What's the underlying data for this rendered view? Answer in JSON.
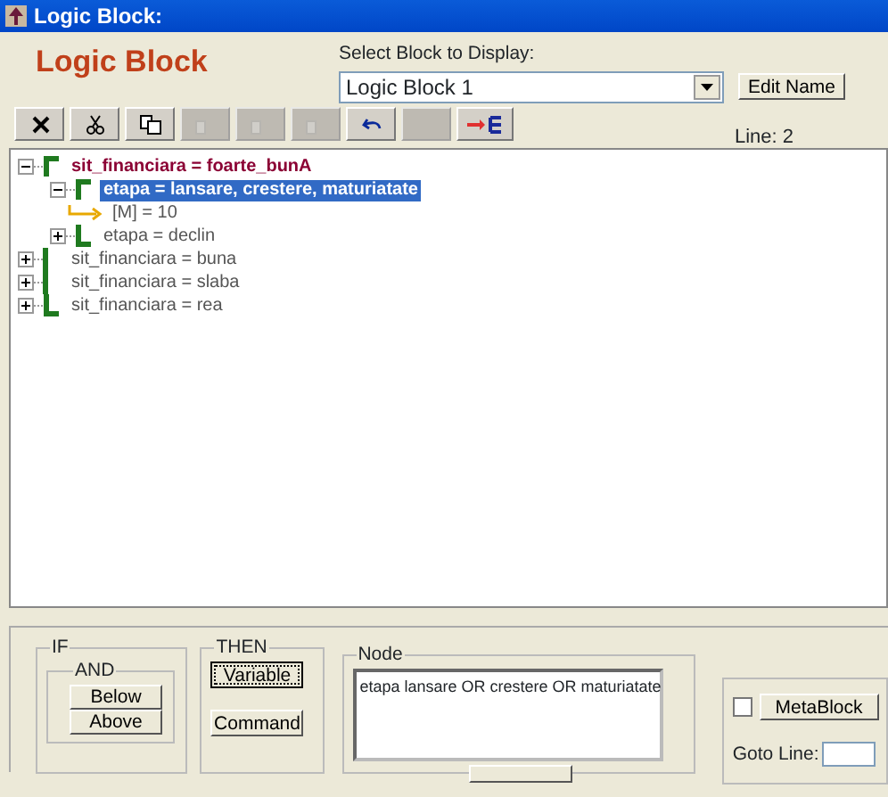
{
  "window": {
    "title": "Logic Block:"
  },
  "heading": "Logic Block",
  "block_select": {
    "label": "Select Block to Display:",
    "value": "Logic Block 1",
    "edit_button": "Edit Name"
  },
  "toolbar": [
    {
      "kind": "delete",
      "disabled": false
    },
    {
      "kind": "cut",
      "disabled": false
    },
    {
      "kind": "copy",
      "disabled": false
    },
    {
      "kind": "paste",
      "disabled": true
    },
    {
      "kind": "paste",
      "disabled": true
    },
    {
      "kind": "paste",
      "disabled": true
    },
    {
      "kind": "undo",
      "disabled": false
    },
    {
      "kind": "blank",
      "disabled": true
    },
    {
      "kind": "tree",
      "disabled": false
    }
  ],
  "line_indicator": "Line: 2",
  "tree": [
    {
      "kind": "condition",
      "text": "sit_financiara = foarte_bunA",
      "bracket_start": true,
      "bracket_end": false,
      "expanded": true,
      "selected": false,
      "children": [
        {
          "kind": "condition",
          "text": "etapa = lansare, crestere, maturiatate",
          "bracket_start": true,
          "bracket_end": false,
          "expanded": true,
          "selected": true,
          "children": [
            {
              "kind": "action",
              "text": "[M] = 10",
              "selected": false
            }
          ]
        },
        {
          "kind": "condition",
          "text": "etapa = declin",
          "bracket_start": false,
          "bracket_end": true,
          "expanded": false,
          "selected": false
        }
      ]
    },
    {
      "kind": "condition",
      "text": "sit_financiara = buna",
      "bracket_start": false,
      "bracket_end": false,
      "expanded": false,
      "selected": false
    },
    {
      "kind": "condition",
      "text": "sit_financiara = slaba",
      "bracket_start": false,
      "bracket_end": false,
      "expanded": false,
      "selected": false
    },
    {
      "kind": "condition",
      "text": "sit_financiara = rea",
      "bracket_start": false,
      "bracket_end": true,
      "expanded": false,
      "selected": false
    }
  ],
  "if_group": {
    "title": "IF",
    "and_title": "AND",
    "buttons": [
      "Below",
      "Above"
    ]
  },
  "then_group": {
    "title": "THEN",
    "buttons": [
      {
        "label": "Variable",
        "focused": true
      },
      {
        "label": "Command",
        "focused": false
      }
    ]
  },
  "node_group": {
    "title": "Node",
    "text": "etapa lansare OR crestere OR maturiatate"
  },
  "meta": {
    "checked": false,
    "button": "MetaBlock",
    "goto_label": "Goto Line:"
  }
}
